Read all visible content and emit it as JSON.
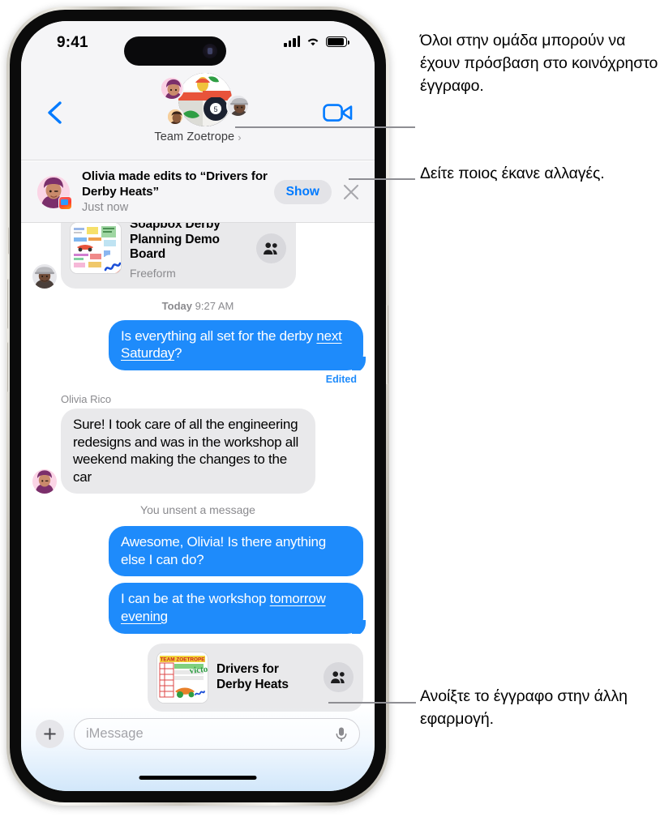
{
  "status_bar": {
    "time": "9:41",
    "cellular": "signal-bars",
    "wifi": "wifi-icon",
    "battery": "battery-full-icon"
  },
  "nav": {
    "back": "back-chevron",
    "facetime": "facetime-video-icon",
    "group_name": "Team Zoetrope",
    "group_chevron": "›"
  },
  "notification": {
    "title": "Olivia made edits to “Drivers for Derby Heats”",
    "timestamp": "Just now",
    "show_label": "Show",
    "close_label": "✕"
  },
  "conversation": {
    "freeform_card": {
      "title": "Soapbox Derby Planning Demo Board",
      "app": "Freeform",
      "participants_icon": "people-icon"
    },
    "timestamp_divider": {
      "day": "Today",
      "time": "9:27 AM"
    },
    "messages": [
      {
        "id": "m1",
        "side": "outgoing",
        "text_plain": "Is everything all set for the derby ",
        "text_link": "next Saturday",
        "text_tail": "?",
        "status": "Edited"
      },
      {
        "id": "m2",
        "side": "incoming",
        "sender": "Olivia Rico",
        "text": "Sure! I took care of all the engineering redesigns and was in the workshop all weekend making the changes to the car"
      },
      {
        "id": "sys1",
        "side": "system",
        "text": "You unsent a message"
      },
      {
        "id": "m3",
        "side": "outgoing",
        "text": "Awesome, Olivia! Is there anything else I can do?"
      },
      {
        "id": "m4",
        "side": "outgoing",
        "text_plain": "I can be at the workshop ",
        "text_link": "tomorrow evening",
        "text_tail": ""
      }
    ],
    "shared_doc_card": {
      "title": "Drivers for Derby Heats",
      "participants_icon": "people-icon"
    }
  },
  "input_bar": {
    "plus_label": "+",
    "placeholder": "iMessage",
    "mic_icon": "microphone-icon"
  },
  "callouts": [
    {
      "id": "c1",
      "text": "Όλοι στην ομάδα μπορούν να έχουν πρόσβαση στο κοινόχρηστο έγγραφο."
    },
    {
      "id": "c2",
      "text": "Δείτε ποιος έκανε αλλαγές."
    },
    {
      "id": "c3",
      "text": "Ανοίξτε το έγγραφο στην άλλη εφαρμογή."
    }
  ],
  "colors": {
    "imessage_blue": "#1e8bfb",
    "bubble_gray": "#e9e9eb",
    "accent_link": "#007aff",
    "secondary_text": "#8a8a8e",
    "leader_line": "#8e8e93"
  }
}
